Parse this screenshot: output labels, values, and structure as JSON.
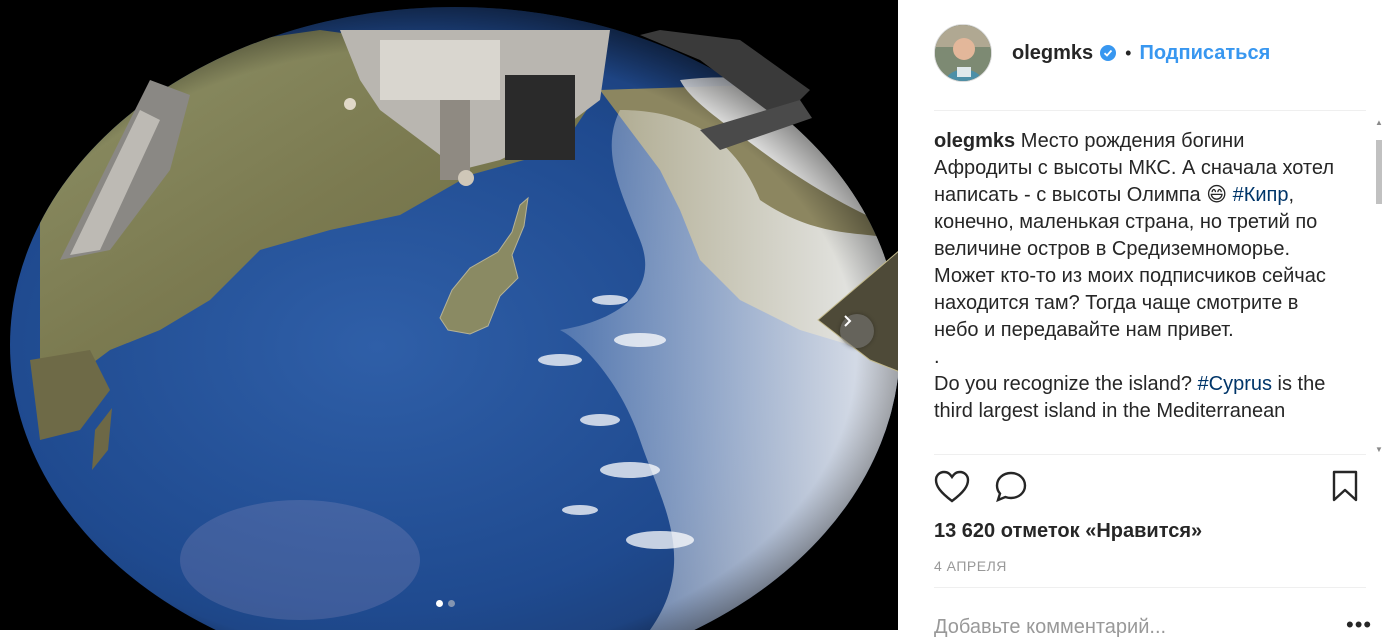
{
  "post": {
    "username": "olegmks",
    "separator": "•",
    "follow_label": "Подписаться",
    "caption_user": "olegmks",
    "caption_ru_1": " Место рождения богини Афродиты с высоты МКС. А сначала хотел написать - с высоты Олимпа 😄 ",
    "hashtag_1": "#Кипр",
    "caption_ru_2": ", конечно, маленькая страна, но третий по величине остров в Средиземноморье. Может кто-то из моих подписчиков сейчас находится там? Тогда чаще смотрите в небо и передавайте нам привет.",
    "caption_dot": ".",
    "caption_en_1": "Do you recognize the island? ",
    "hashtag_2": "#Cyprus",
    "caption_en_2": " is the third largest island in the Mediterranean",
    "likes_text": "13 620 отметок «Нравится»",
    "date_text": "4 АПРЕЛЯ",
    "comment_placeholder": "Добавьте комментарий...",
    "more_options": "•••"
  },
  "carousel": {
    "count": 2,
    "active": 1
  },
  "icons": {
    "verified": "verified-badge-icon",
    "like": "heart-icon",
    "comment": "comment-bubble-icon",
    "save": "bookmark-icon",
    "next": "chevron-right-icon"
  },
  "colors": {
    "link": "#3897f0",
    "hashtag": "#003569",
    "muted": "#999999",
    "text": "#262626"
  }
}
